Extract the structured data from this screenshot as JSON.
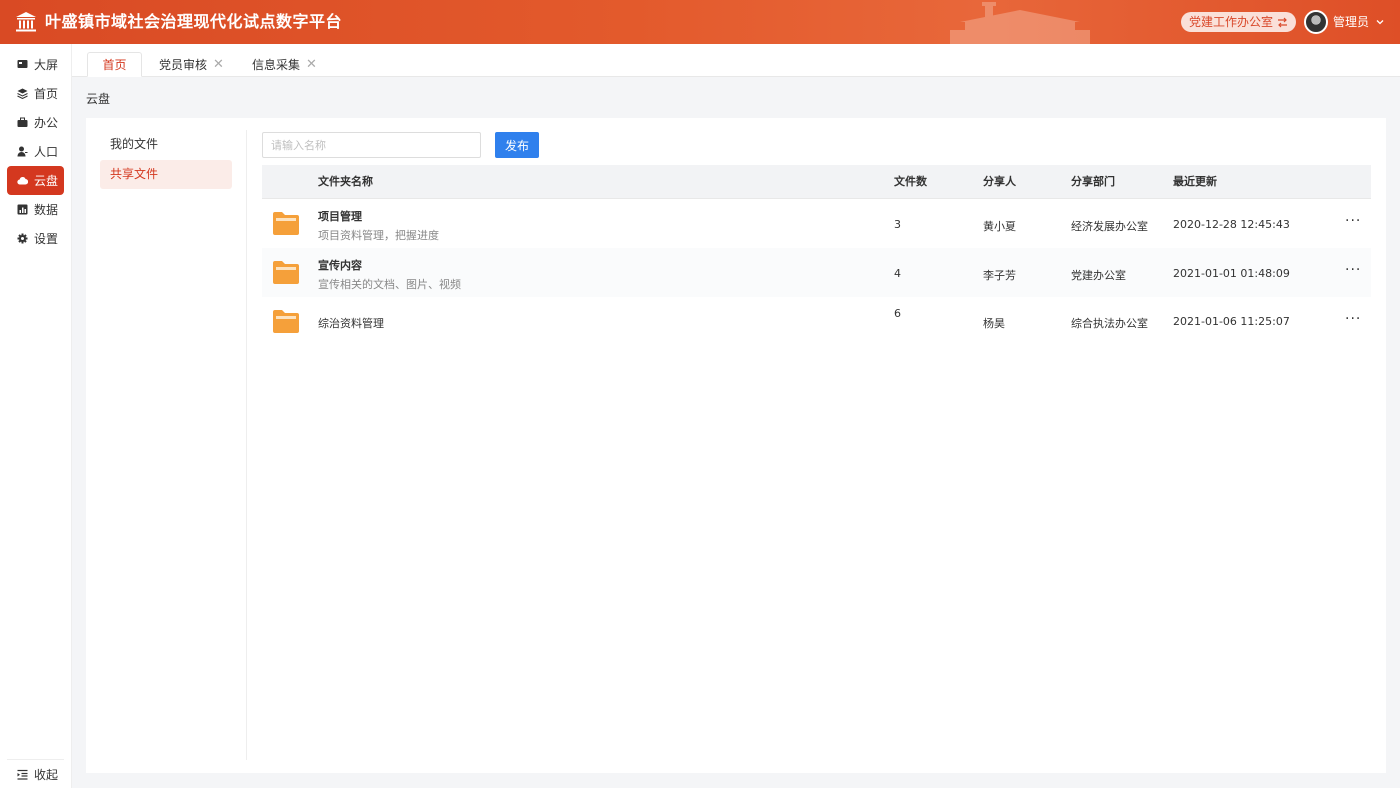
{
  "header": {
    "title": "叶盛镇市域社会治理现代化试点数字平台",
    "org_button": "党建工作办公室",
    "user_name": "管理员",
    "colors": {
      "primary": "#d4381f",
      "header_bg": "#e35a2c",
      "publish": "#2f80ed",
      "folder": "#f5a03a"
    }
  },
  "sidebar": {
    "items": [
      {
        "label": "大屏",
        "icon": "monitor-icon"
      },
      {
        "label": "首页",
        "icon": "layers-icon"
      },
      {
        "label": "办公",
        "icon": "briefcase-icon"
      },
      {
        "label": "人口",
        "icon": "person-icon"
      },
      {
        "label": "云盘",
        "icon": "cloud-icon",
        "active": true
      },
      {
        "label": "数据",
        "icon": "chart-icon"
      },
      {
        "label": "设置",
        "icon": "gear-icon"
      }
    ],
    "collapse_label": "收起"
  },
  "tabs": [
    {
      "label": "首页",
      "active": true
    },
    {
      "label": "党员审核",
      "closable": true
    },
    {
      "label": "信息采集",
      "closable": true
    }
  ],
  "breadcrumb": "云盘",
  "left_menu": {
    "items": [
      {
        "label": "我的文件"
      },
      {
        "label": "共享文件",
        "active": true
      }
    ]
  },
  "toolbar": {
    "search_placeholder": "请输入名称",
    "publish_label": "发布"
  },
  "table": {
    "headers": [
      "文件夹名称",
      "文件数",
      "分享人",
      "分享部门",
      "最近更新"
    ],
    "rows": [
      {
        "name": "项目管理",
        "desc": "项目资料管理，把握进度",
        "count": "3",
        "sharer": "黄小夏",
        "dept": "经济发展办公室",
        "updated": "2020-12-28 12:45:43"
      },
      {
        "name": "宣传内容",
        "desc": "宣传相关的文档、图片、视频",
        "count": "4",
        "sharer": "李子芳",
        "dept": "党建办公室",
        "updated": "2021-01-01 01:48:09"
      },
      {
        "name": "综治资料管理",
        "desc": "",
        "count": "6",
        "sharer": "杨昊",
        "dept": "综合执法办公室",
        "updated": "2021-01-06 11:25:07"
      }
    ]
  }
}
